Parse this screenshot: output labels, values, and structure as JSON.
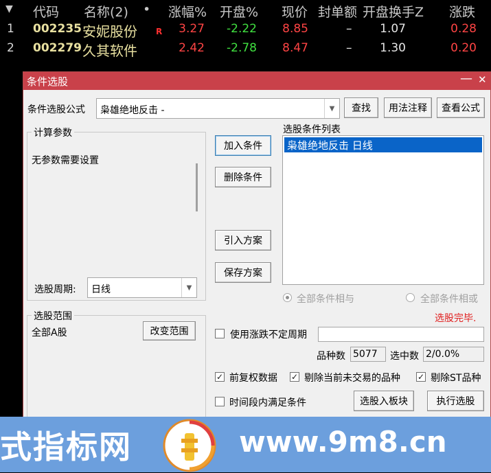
{
  "table": {
    "header": {
      "sort_icon": "▼",
      "code": "代码",
      "name": "名称(2)",
      "dot": "•",
      "change_pct": "涨幅%",
      "open_pct": "开盘%",
      "price": "现价",
      "seal_amount": "封单额",
      "open_turnover": "开盘换手Z",
      "change": "涨跌"
    },
    "rows": [
      {
        "idx": "1",
        "code": "002235",
        "name": "安妮股份",
        "flag": "R",
        "change_pct": "3.27",
        "open_pct": "-2.22",
        "price": "8.85",
        "seal": "–",
        "turnover": "1.07",
        "change": "0.28"
      },
      {
        "idx": "2",
        "code": "002279",
        "name": "久其软件",
        "flag": "",
        "change_pct": "2.42",
        "open_pct": "-2.78",
        "price": "8.47",
        "seal": "–",
        "turnover": "1.30",
        "change": "0.20"
      }
    ]
  },
  "dialog": {
    "title": "条件选股",
    "minimize": "—",
    "close": "✕",
    "formula_label": "条件选股公式",
    "formula_value": "枭雄绝地反击 -",
    "find_btn": "查找",
    "usage_btn": "用法注释",
    "view_btn": "查看公式",
    "params_group": "计算参数",
    "no_params": "无参数需要设置",
    "period_label": "选股周期:",
    "period_value": "日线",
    "add_btn": "加入条件",
    "delete_btn": "删除条件",
    "import_btn": "引入方案",
    "save_btn": "保存方案",
    "list_label": "选股条件列表",
    "list_items": [
      "枭雄绝地反击  日线"
    ],
    "radio_and": "全部条件相与",
    "radio_or": "全部条件相或",
    "status": "选股完毕.",
    "range_group": "选股范围",
    "range_value": "全部A股",
    "change_range_btn": "改变范围",
    "use_period_chk": "使用涨跌不定周期",
    "count_label": "品种数",
    "count_value": "5077",
    "selected_label": "选中数",
    "selected_value": "2/0.0%",
    "fq_chk": "前复权数据",
    "exclude_untraded_chk": "剔除当前未交易的品种",
    "exclude_st_chk": "剔除ST品种",
    "time_chk": "时间段内满足条件",
    "to_block_btn": "选股入板块",
    "run_btn": "执行选股"
  },
  "watermark": {
    "left_text": "式指标网",
    "url": "www.9m8.cn",
    "logo_small": "www.9m8.cn"
  }
}
